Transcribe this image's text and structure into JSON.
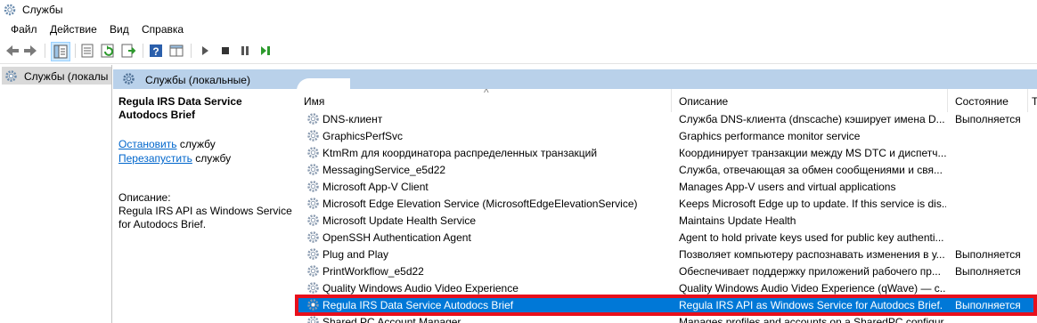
{
  "window": {
    "title": "Службы"
  },
  "menu": [
    "Файл",
    "Действие",
    "Вид",
    "Справка"
  ],
  "toolbar": {
    "icons": [
      "back-icon",
      "forward-icon",
      "console-tree-icon",
      "properties-icon",
      "refresh-icon",
      "export-icon",
      "help-icon",
      "view-icon",
      "play-icon",
      "stop-icon",
      "pause-icon",
      "restart-icon"
    ]
  },
  "tree": {
    "item": "Службы (локалы"
  },
  "pane": {
    "header": "Службы (локальные)"
  },
  "details": {
    "service_name": "Regula IRS Data Service Autodocs Brief",
    "stop_link": "Остановить",
    "stop_suffix": " службу",
    "restart_link": "Перезапустить",
    "restart_suffix": " службу",
    "desc_label": "Описание:",
    "desc_text": "Regula IRS API as Windows Service for Autodocs Brief."
  },
  "columns": {
    "name": "Имя",
    "desc": "Описание",
    "state": "Состояние",
    "extra": "Т"
  },
  "rows": [
    {
      "name": "DNS-клиент",
      "desc": "Служба DNS-клиента (dnscache) кэширует имена D...",
      "state": "Выполняется"
    },
    {
      "name": "GraphicsPerfSvc",
      "desc": "Graphics performance monitor service",
      "state": ""
    },
    {
      "name": "KtmRm для координатора распределенных транзакций",
      "desc": "Координирует транзакции между MS DTC и диспетч...",
      "state": ""
    },
    {
      "name": "MessagingService_e5d22",
      "desc": "Служба, отвечающая за обмен сообщениями и свя...",
      "state": ""
    },
    {
      "name": "Microsoft App-V Client",
      "desc": "Manages App-V users and virtual applications",
      "state": ""
    },
    {
      "name": "Microsoft Edge Elevation Service (MicrosoftEdgeElevationService)",
      "desc": "Keeps Microsoft Edge up to update. If this service is dis...",
      "state": ""
    },
    {
      "name": "Microsoft Update Health Service",
      "desc": "Maintains Update Health",
      "state": ""
    },
    {
      "name": "OpenSSH Authentication Agent",
      "desc": "Agent to hold private keys used for public key authenti...",
      "state": ""
    },
    {
      "name": "Plug and Play",
      "desc": "Позволяет компьютеру распознавать изменения в у...",
      "state": "Выполняется"
    },
    {
      "name": "PrintWorkflow_e5d22",
      "desc": "Обеспечивает поддержку приложений рабочего пр...",
      "state": "Выполняется"
    },
    {
      "name": "Quality Windows Audio Video Experience",
      "desc": "Quality Windows Audio Video Experience (qWave) — с...",
      "state": ""
    },
    {
      "name": "Regula IRS Data Service Autodocs Brief",
      "desc": "Regula IRS API as Windows Service for Autodocs Brief.",
      "state": "Выполняется"
    },
    {
      "name": "Shared PC Account Manager",
      "desc": "Manages profiles and accounts on a SharedPC configur...",
      "state": ""
    }
  ]
}
